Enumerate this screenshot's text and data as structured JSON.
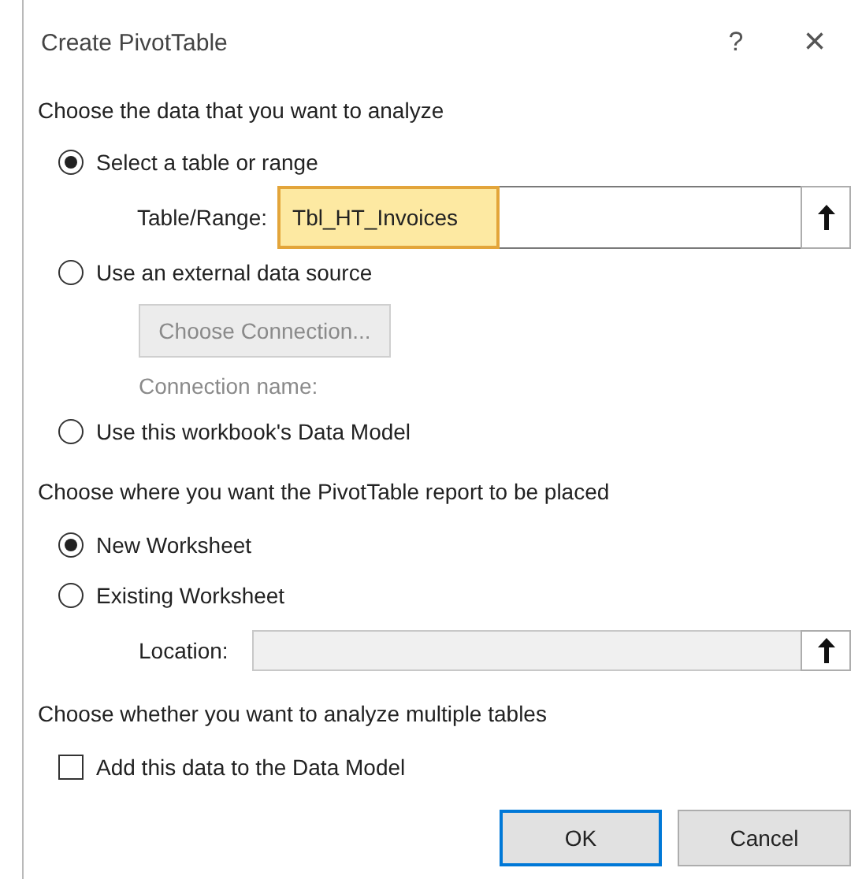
{
  "window": {
    "title": "Create PivotTable",
    "help": "?",
    "close": "×"
  },
  "source": {
    "heading": "Choose the data that you want to analyze",
    "options": [
      {
        "label": "Select a table or range",
        "selected": true
      },
      {
        "label": "Use an external data source",
        "selected": false
      },
      {
        "label": "Use this workbook's Data Model",
        "selected": false
      }
    ],
    "table_range": {
      "label": "Table/Range:",
      "value": "Tbl_HT_Invoices",
      "highlighted": true
    },
    "connection_button": {
      "label": "Choose Connection...",
      "disabled": true
    },
    "connection_name": {
      "label": "Connection name:",
      "disabled": true
    }
  },
  "placement": {
    "heading": "Choose where you want the PivotTable report to be placed",
    "options": [
      {
        "label": "New Worksheet",
        "selected": true
      },
      {
        "label": "Existing Worksheet",
        "selected": false
      }
    ],
    "location": {
      "label": "Location:",
      "disabled": true
    }
  },
  "multiple": {
    "heading": "Choose whether you want to analyze multiple tables",
    "checkbox": {
      "label": "Add this data to the Data Model",
      "checked": false
    }
  },
  "buttons": [
    {
      "label": "OK",
      "default": true
    },
    {
      "label": "Cancel",
      "default": false
    }
  ]
}
